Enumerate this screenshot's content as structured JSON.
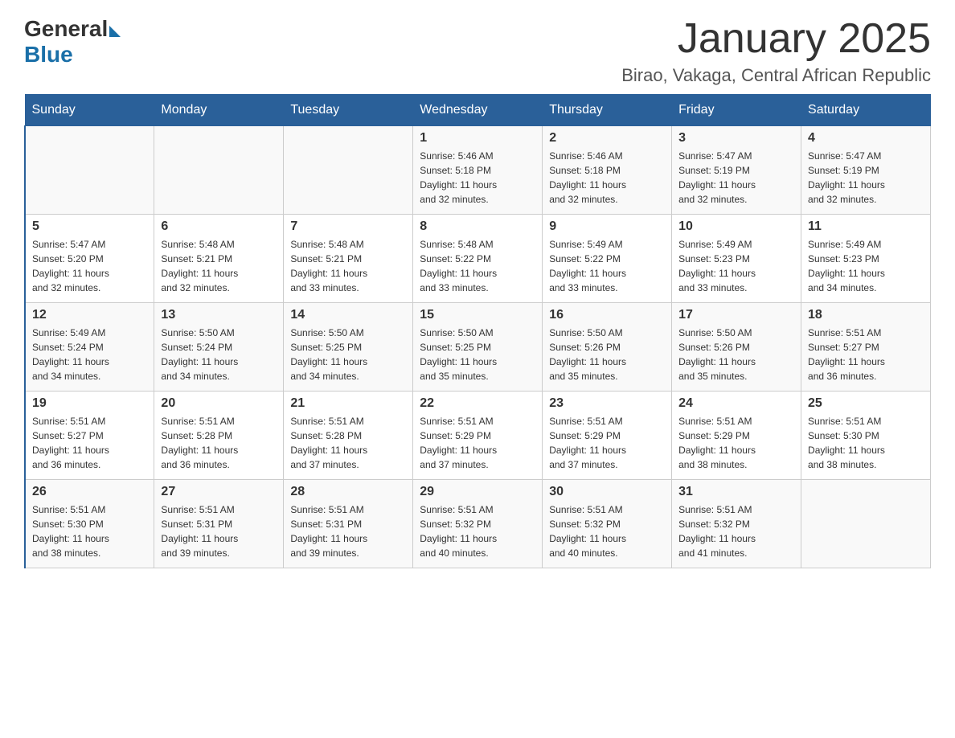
{
  "header": {
    "logo_general": "General",
    "logo_blue": "Blue",
    "title": "January 2025",
    "subtitle": "Birao, Vakaga, Central African Republic"
  },
  "weekdays": [
    "Sunday",
    "Monday",
    "Tuesday",
    "Wednesday",
    "Thursday",
    "Friday",
    "Saturday"
  ],
  "weeks": [
    [
      {
        "day": "",
        "info": ""
      },
      {
        "day": "",
        "info": ""
      },
      {
        "day": "",
        "info": ""
      },
      {
        "day": "1",
        "info": "Sunrise: 5:46 AM\nSunset: 5:18 PM\nDaylight: 11 hours\nand 32 minutes."
      },
      {
        "day": "2",
        "info": "Sunrise: 5:46 AM\nSunset: 5:18 PM\nDaylight: 11 hours\nand 32 minutes."
      },
      {
        "day": "3",
        "info": "Sunrise: 5:47 AM\nSunset: 5:19 PM\nDaylight: 11 hours\nand 32 minutes."
      },
      {
        "day": "4",
        "info": "Sunrise: 5:47 AM\nSunset: 5:19 PM\nDaylight: 11 hours\nand 32 minutes."
      }
    ],
    [
      {
        "day": "5",
        "info": "Sunrise: 5:47 AM\nSunset: 5:20 PM\nDaylight: 11 hours\nand 32 minutes."
      },
      {
        "day": "6",
        "info": "Sunrise: 5:48 AM\nSunset: 5:21 PM\nDaylight: 11 hours\nand 32 minutes."
      },
      {
        "day": "7",
        "info": "Sunrise: 5:48 AM\nSunset: 5:21 PM\nDaylight: 11 hours\nand 33 minutes."
      },
      {
        "day": "8",
        "info": "Sunrise: 5:48 AM\nSunset: 5:22 PM\nDaylight: 11 hours\nand 33 minutes."
      },
      {
        "day": "9",
        "info": "Sunrise: 5:49 AM\nSunset: 5:22 PM\nDaylight: 11 hours\nand 33 minutes."
      },
      {
        "day": "10",
        "info": "Sunrise: 5:49 AM\nSunset: 5:23 PM\nDaylight: 11 hours\nand 33 minutes."
      },
      {
        "day": "11",
        "info": "Sunrise: 5:49 AM\nSunset: 5:23 PM\nDaylight: 11 hours\nand 34 minutes."
      }
    ],
    [
      {
        "day": "12",
        "info": "Sunrise: 5:49 AM\nSunset: 5:24 PM\nDaylight: 11 hours\nand 34 minutes."
      },
      {
        "day": "13",
        "info": "Sunrise: 5:50 AM\nSunset: 5:24 PM\nDaylight: 11 hours\nand 34 minutes."
      },
      {
        "day": "14",
        "info": "Sunrise: 5:50 AM\nSunset: 5:25 PM\nDaylight: 11 hours\nand 34 minutes."
      },
      {
        "day": "15",
        "info": "Sunrise: 5:50 AM\nSunset: 5:25 PM\nDaylight: 11 hours\nand 35 minutes."
      },
      {
        "day": "16",
        "info": "Sunrise: 5:50 AM\nSunset: 5:26 PM\nDaylight: 11 hours\nand 35 minutes."
      },
      {
        "day": "17",
        "info": "Sunrise: 5:50 AM\nSunset: 5:26 PM\nDaylight: 11 hours\nand 35 minutes."
      },
      {
        "day": "18",
        "info": "Sunrise: 5:51 AM\nSunset: 5:27 PM\nDaylight: 11 hours\nand 36 minutes."
      }
    ],
    [
      {
        "day": "19",
        "info": "Sunrise: 5:51 AM\nSunset: 5:27 PM\nDaylight: 11 hours\nand 36 minutes."
      },
      {
        "day": "20",
        "info": "Sunrise: 5:51 AM\nSunset: 5:28 PM\nDaylight: 11 hours\nand 36 minutes."
      },
      {
        "day": "21",
        "info": "Sunrise: 5:51 AM\nSunset: 5:28 PM\nDaylight: 11 hours\nand 37 minutes."
      },
      {
        "day": "22",
        "info": "Sunrise: 5:51 AM\nSunset: 5:29 PM\nDaylight: 11 hours\nand 37 minutes."
      },
      {
        "day": "23",
        "info": "Sunrise: 5:51 AM\nSunset: 5:29 PM\nDaylight: 11 hours\nand 37 minutes."
      },
      {
        "day": "24",
        "info": "Sunrise: 5:51 AM\nSunset: 5:29 PM\nDaylight: 11 hours\nand 38 minutes."
      },
      {
        "day": "25",
        "info": "Sunrise: 5:51 AM\nSunset: 5:30 PM\nDaylight: 11 hours\nand 38 minutes."
      }
    ],
    [
      {
        "day": "26",
        "info": "Sunrise: 5:51 AM\nSunset: 5:30 PM\nDaylight: 11 hours\nand 38 minutes."
      },
      {
        "day": "27",
        "info": "Sunrise: 5:51 AM\nSunset: 5:31 PM\nDaylight: 11 hours\nand 39 minutes."
      },
      {
        "day": "28",
        "info": "Sunrise: 5:51 AM\nSunset: 5:31 PM\nDaylight: 11 hours\nand 39 minutes."
      },
      {
        "day": "29",
        "info": "Sunrise: 5:51 AM\nSunset: 5:32 PM\nDaylight: 11 hours\nand 40 minutes."
      },
      {
        "day": "30",
        "info": "Sunrise: 5:51 AM\nSunset: 5:32 PM\nDaylight: 11 hours\nand 40 minutes."
      },
      {
        "day": "31",
        "info": "Sunrise: 5:51 AM\nSunset: 5:32 PM\nDaylight: 11 hours\nand 41 minutes."
      },
      {
        "day": "",
        "info": ""
      }
    ]
  ]
}
